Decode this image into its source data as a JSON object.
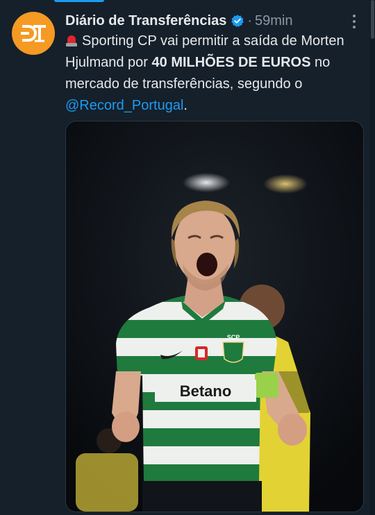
{
  "account": {
    "display_name": "Diário de Transferências",
    "verified": true,
    "avatar_initials": "DT",
    "avatar_color": "#f59a23"
  },
  "tweet": {
    "separator": "·",
    "time": "59min",
    "text_part1": "Sporting CP vai permitir a saída de Morten Hjulmand por ",
    "text_bold": "40 MILHÕES DE EUROS",
    "text_part2": " no mercado de transferências, segundo o ",
    "mention": "@Record_Portugal",
    "text_end": "."
  },
  "media": {
    "sponsor_text": "Betano",
    "crest_text": "SCP"
  },
  "icons": {
    "siren": "police-car-light-emoji",
    "verified": "verified-badge-icon",
    "more": "more-options-icon"
  },
  "colors": {
    "background": "#15202b",
    "link": "#1d9bf0",
    "secondary_text": "#8b98a5",
    "verified": "#1d9bf0",
    "jersey_green": "#1f7a3e"
  }
}
